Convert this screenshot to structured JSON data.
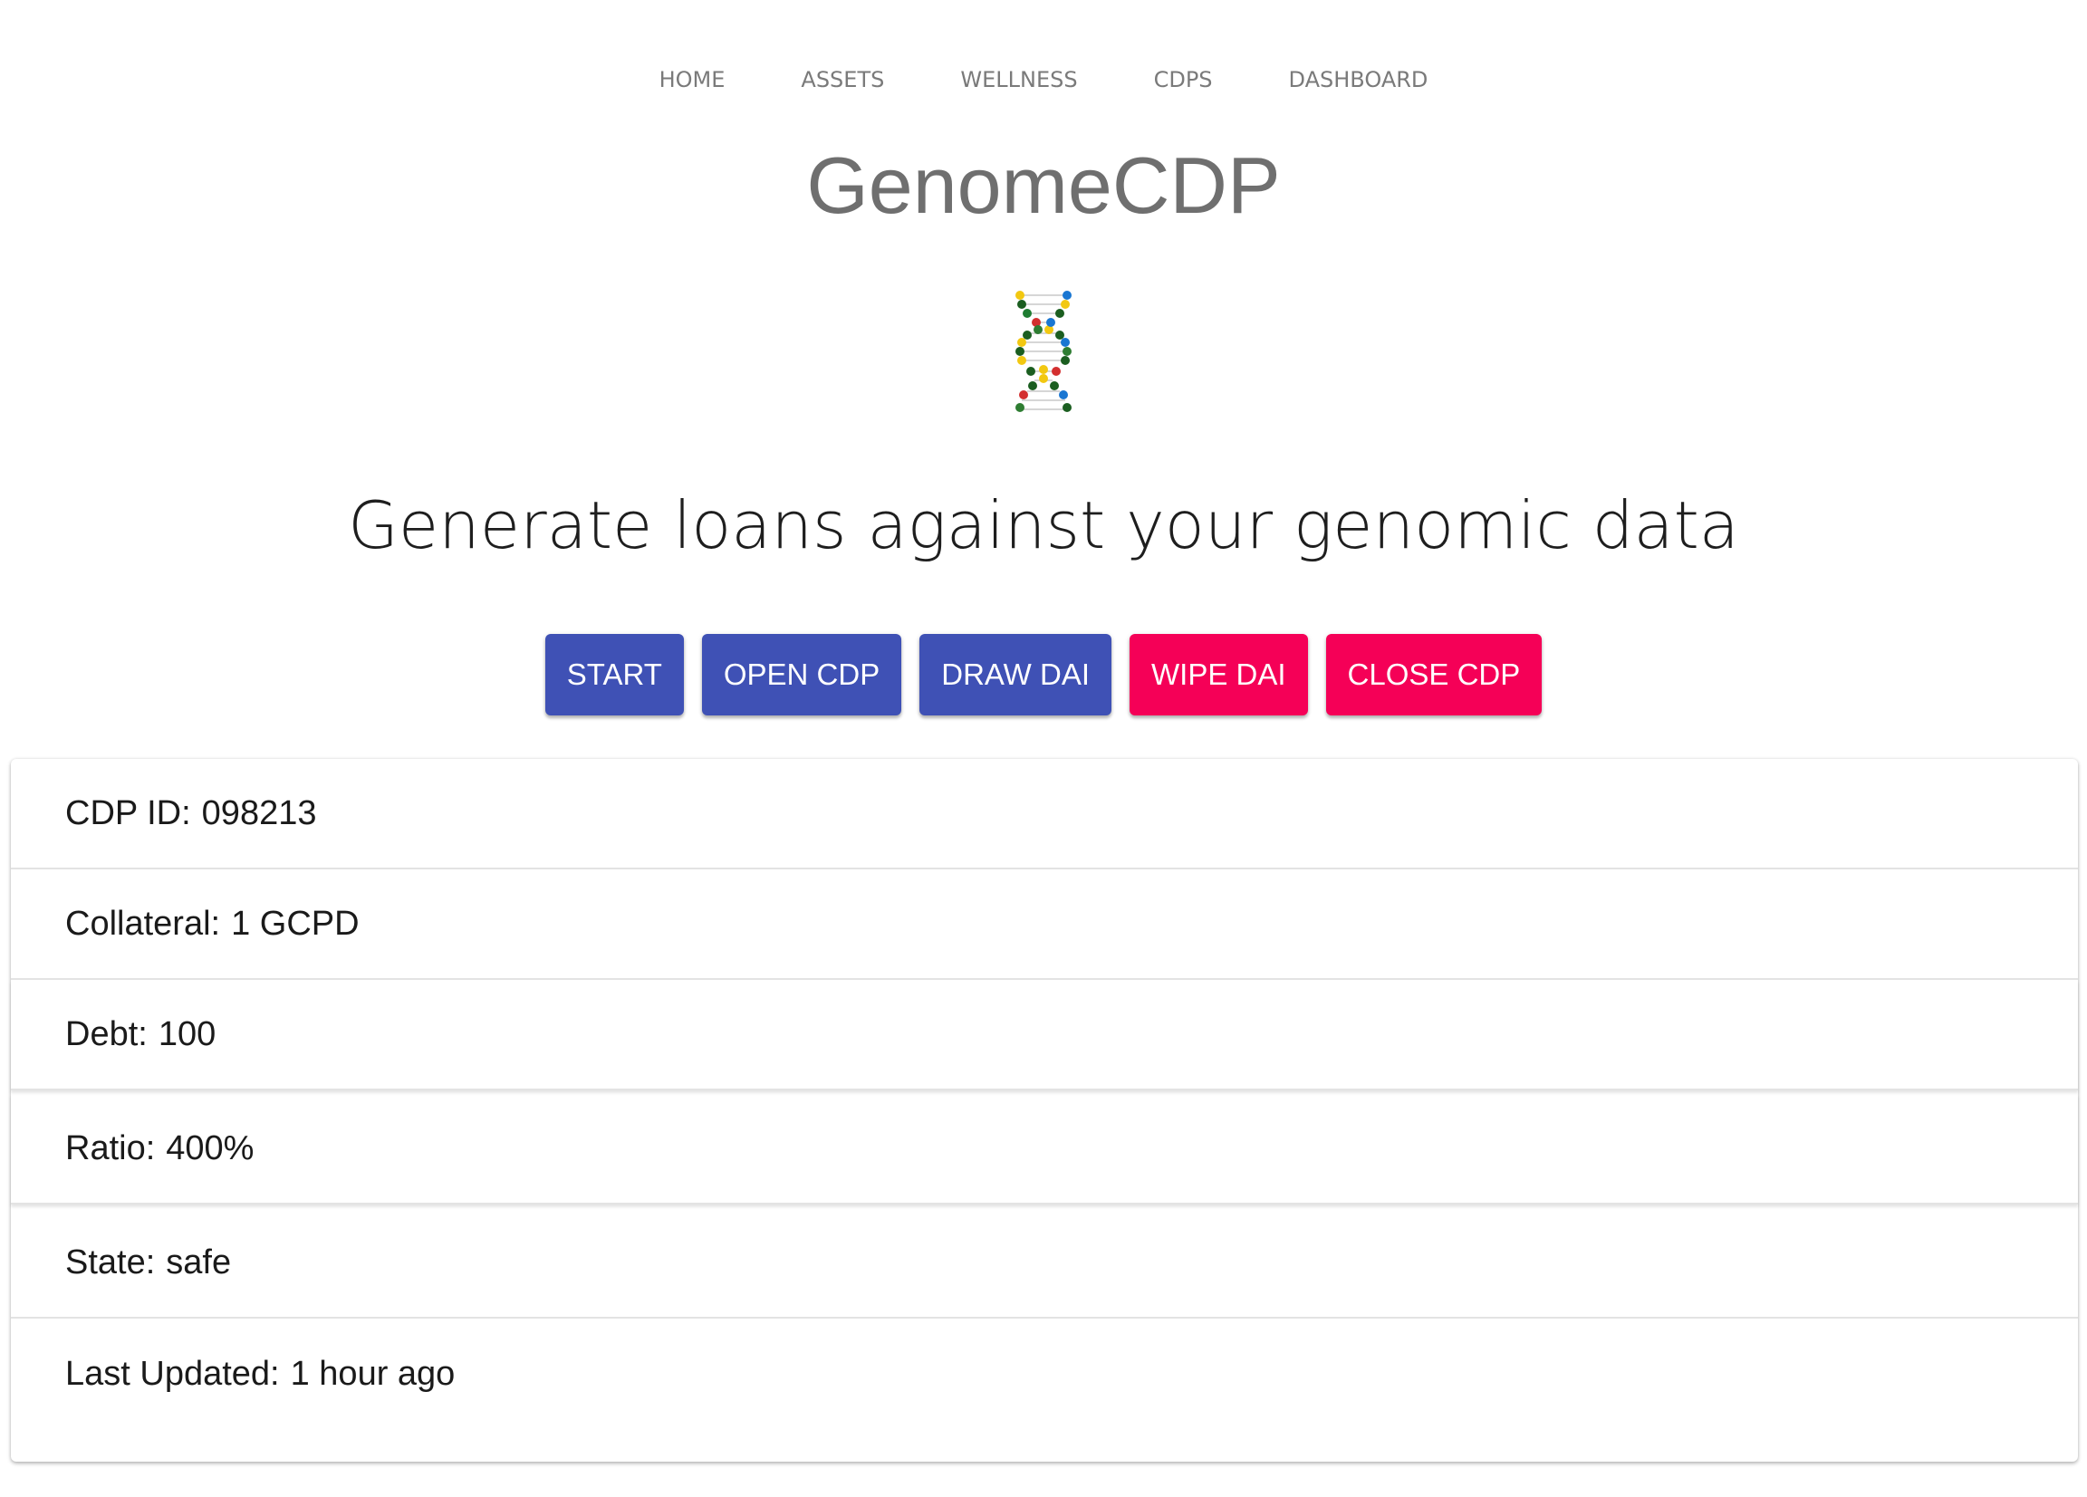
{
  "nav": {
    "items": [
      {
        "label": "HOME"
      },
      {
        "label": "ASSETS"
      },
      {
        "label": "WELLNESS"
      },
      {
        "label": "CDPS"
      },
      {
        "label": "DASHBOARD"
      }
    ]
  },
  "header": {
    "title": "GenomeCDP",
    "logo_icon": "dna-helix-icon",
    "tagline": "Generate loans against your genomic data"
  },
  "actions": {
    "start": "START",
    "open_cdp": "OPEN CDP",
    "draw_dai": "DRAW DAI",
    "wipe_dai": "WIPE DAI",
    "close_cdp": "CLOSE CDP"
  },
  "colors": {
    "primary": "#3f51b5",
    "danger": "#f50057",
    "nav_text": "#7a7a7a",
    "title_text": "#6f6f6f"
  },
  "cdp": {
    "id_label": "CDP ID:",
    "id_value": "098213",
    "collateral_label": "Collateral:",
    "collateral_value": "1 GCPD",
    "debt_label": "Debt:",
    "debt_value": "100",
    "ratio_label": "Ratio:",
    "ratio_value": "400%",
    "state_label": "State:",
    "state_value": "safe",
    "updated_label": "Last Updated:",
    "updated_value": "1 hour ago"
  }
}
